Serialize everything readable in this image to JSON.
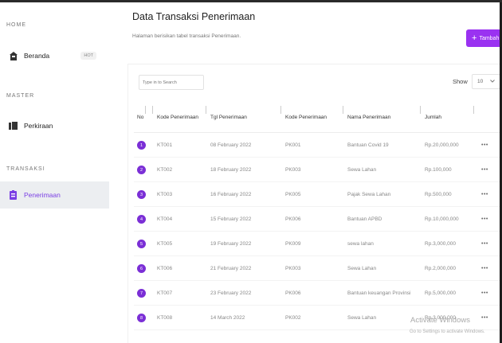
{
  "sidebar": {
    "sections": [
      {
        "title": "HOME"
      },
      {
        "title": "MASTER"
      },
      {
        "title": "TRANSAKSI"
      }
    ],
    "items": [
      {
        "label": "Beranda",
        "badge": "HOT",
        "icon": "home-icon"
      },
      {
        "label": "Perkiraan",
        "icon": "book-icon"
      },
      {
        "label": "Penerimaan",
        "icon": "clipboard-icon",
        "active": true
      }
    ]
  },
  "header": {
    "title": "Data Transaksi Penerimaan",
    "subtitle": "Halaman berisikan tabel transaksi Penerimaan.",
    "add_label": "Tambah"
  },
  "search": {
    "placeholder": "Type in to Search"
  },
  "show": {
    "label": "Show",
    "value": "10"
  },
  "table": {
    "headers": [
      "No",
      "Kode Penerimaan",
      "Tgl Penerimaan",
      "Kode Penerimaan",
      "Nama Penerimaan",
      "Jumlah"
    ],
    "rows": [
      {
        "no": "1",
        "kode": "KT001",
        "tgl": "08 February 2022",
        "kode2": "PK001",
        "nama": "Bantuan Covid 19",
        "jumlah": "Rp.20,000,000"
      },
      {
        "no": "2",
        "kode": "KT002",
        "tgl": "18 February 2022",
        "kode2": "PK003",
        "nama": "Sewa Lahan",
        "jumlah": "Rp.100,000"
      },
      {
        "no": "3",
        "kode": "KT003",
        "tgl": "16 February 2022",
        "kode2": "PK005",
        "nama": "Pajak Sewa Lahan",
        "jumlah": "Rp.500,000"
      },
      {
        "no": "4",
        "kode": "KT004",
        "tgl": "15 February 2022",
        "kode2": "PK006",
        "nama": "Bantuan APBD",
        "jumlah": "Rp.10,000,000"
      },
      {
        "no": "5",
        "kode": "KT005",
        "tgl": "19 February 2022",
        "kode2": "PK009",
        "nama": "sewa lahan",
        "jumlah": "Rp.3,000,000"
      },
      {
        "no": "6",
        "kode": "KT006",
        "tgl": "21 February 2022",
        "kode2": "PK003",
        "nama": "Sewa Lahan",
        "jumlah": "Rp.2,000,000"
      },
      {
        "no": "7",
        "kode": "KT007",
        "tgl": "23 February 2022",
        "kode2": "PK006",
        "nama": "Bantuan keuangan Provinsi",
        "jumlah": "Rp.5,000,000"
      },
      {
        "no": "8",
        "kode": "KT008",
        "tgl": "14 March 2022",
        "kode2": "PK002",
        "nama": "Sewa Lahan",
        "jumlah": "Rp.3,000,000"
      }
    ],
    "more_label": "•••"
  },
  "watermark": {
    "title": "Activate Windows",
    "sub": "Go to Settings to activate Windows."
  },
  "colors": {
    "accent": "#7b2fd6",
    "button": "#9a32f1"
  }
}
